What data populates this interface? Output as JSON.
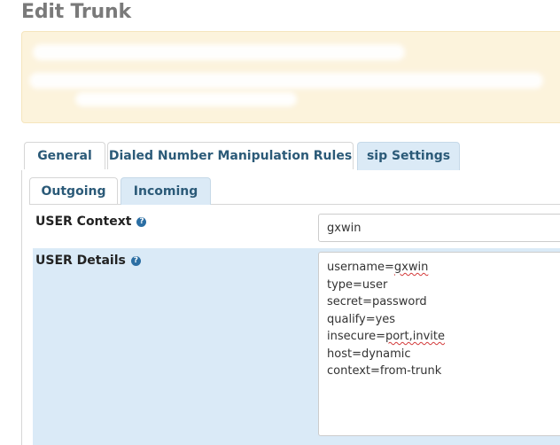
{
  "page": {
    "title": "Edit Trunk"
  },
  "tabs": [
    {
      "label": "General"
    },
    {
      "label": "Dialed Number Manipulation Rules"
    },
    {
      "label": "sip Settings",
      "active": true
    }
  ],
  "subtabs": [
    {
      "label": "Outgoing"
    },
    {
      "label": "Incoming",
      "active": true
    }
  ],
  "user_context": {
    "label": "USER Context",
    "value": "gxwin"
  },
  "user_details": {
    "label": "USER Details",
    "lines": [
      {
        "prefix": "username=",
        "flagged": "gxwin",
        "suffix": ""
      },
      {
        "prefix": "type=user",
        "flagged": "",
        "suffix": ""
      },
      {
        "prefix": "secret=password",
        "flagged": "",
        "suffix": ""
      },
      {
        "prefix": "qualify=yes",
        "flagged": "",
        "suffix": ""
      },
      {
        "prefix": "insecure=",
        "flagged": "port,invite",
        "suffix": ""
      },
      {
        "prefix": "host=dynamic",
        "flagged": "",
        "suffix": ""
      },
      {
        "prefix": "context=from-trunk",
        "flagged": "",
        "suffix": ""
      }
    ]
  },
  "colors": {
    "title": "#7a7a7a",
    "notice_bg": "#fcf3dc",
    "tab_text": "#2b5a78",
    "active_tab_bg": "#dbeaf6",
    "details_bg": "#daeaf7",
    "help_icon": "#2b6ea3",
    "spellcheck": "#d33a3a"
  },
  "icons": {
    "help": "question-circle-icon"
  }
}
